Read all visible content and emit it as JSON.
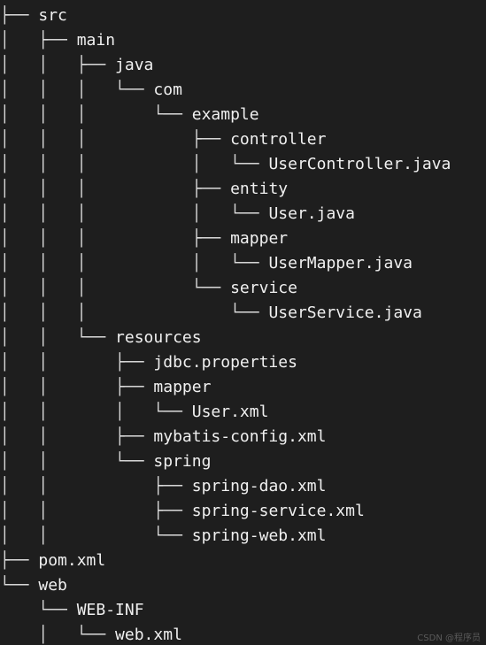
{
  "tree": [
    {
      "guide": "├── ",
      "name": "src"
    },
    {
      "guide": "│   ├── ",
      "name": "main"
    },
    {
      "guide": "│   │   ├── ",
      "name": "java"
    },
    {
      "guide": "│   │   │   └── ",
      "name": "com"
    },
    {
      "guide": "│   │   │       └── ",
      "name": "example"
    },
    {
      "guide": "│   │   │           ├── ",
      "name": "controller"
    },
    {
      "guide": "│   │   │           │   └── ",
      "name": "UserController.java"
    },
    {
      "guide": "│   │   │           ├── ",
      "name": "entity"
    },
    {
      "guide": "│   │   │           │   └── ",
      "name": "User.java"
    },
    {
      "guide": "│   │   │           ├── ",
      "name": "mapper"
    },
    {
      "guide": "│   │   │           │   └── ",
      "name": "UserMapper.java"
    },
    {
      "guide": "│   │   │           └── ",
      "name": "service"
    },
    {
      "guide": "│   │   │               └── ",
      "name": "UserService.java"
    },
    {
      "guide": "│   │   └── ",
      "name": "resources"
    },
    {
      "guide": "│   │       ├── ",
      "name": "jdbc.properties"
    },
    {
      "guide": "│   │       ├── ",
      "name": "mapper"
    },
    {
      "guide": "│   │       │   └── ",
      "name": "User.xml"
    },
    {
      "guide": "│   │       ├── ",
      "name": "mybatis-config.xml"
    },
    {
      "guide": "│   │       └── ",
      "name": "spring"
    },
    {
      "guide": "│   │           ├── ",
      "name": "spring-dao.xml"
    },
    {
      "guide": "│   │           ├── ",
      "name": "spring-service.xml"
    },
    {
      "guide": "│   │           └── ",
      "name": "spring-web.xml"
    },
    {
      "guide": "├── ",
      "name": "pom.xml"
    },
    {
      "guide": "└── ",
      "name": "web"
    },
    {
      "guide": "    └── ",
      "name": "WEB-INF"
    },
    {
      "guide": "    │   └── ",
      "name": "web.xml"
    }
  ],
  "watermark": "CSDN @程序员"
}
